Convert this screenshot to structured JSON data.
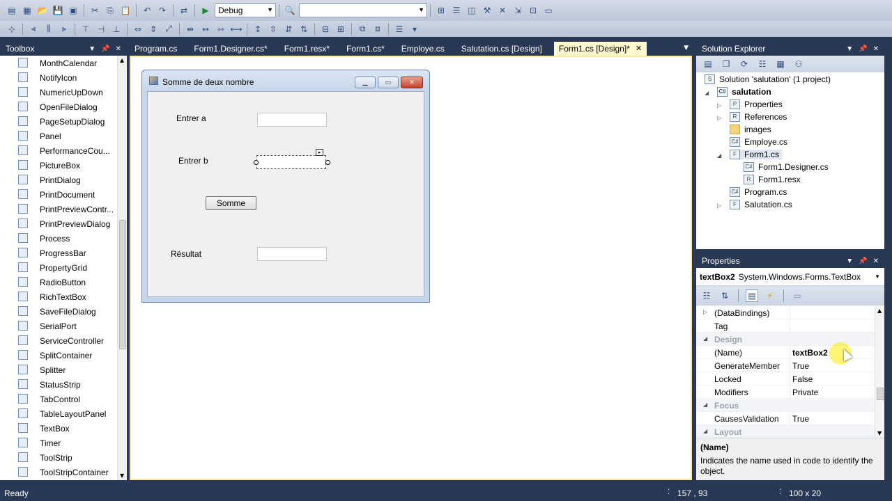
{
  "toolbar": {
    "config": "Debug",
    "platform": ""
  },
  "toolbox": {
    "title": "Toolbox",
    "items": [
      {
        "label": "MonthCalendar",
        "icon": "calendar-icon"
      },
      {
        "label": "NotifyIcon",
        "icon": "notify-icon"
      },
      {
        "label": "NumericUpDown",
        "icon": "numeric-icon"
      },
      {
        "label": "OpenFileDialog",
        "icon": "open-file-icon"
      },
      {
        "label": "PageSetupDialog",
        "icon": "page-setup-icon"
      },
      {
        "label": "Panel",
        "icon": "panel-icon"
      },
      {
        "label": "PerformanceCou...",
        "icon": "perf-icon"
      },
      {
        "label": "PictureBox",
        "icon": "picture-icon"
      },
      {
        "label": "PrintDialog",
        "icon": "print-icon"
      },
      {
        "label": "PrintDocument",
        "icon": "print-doc-icon"
      },
      {
        "label": "PrintPreviewContr...",
        "icon": "print-preview-icon"
      },
      {
        "label": "PrintPreviewDialog",
        "icon": "print-preview-dialog-icon"
      },
      {
        "label": "Process",
        "icon": "process-icon"
      },
      {
        "label": "ProgressBar",
        "icon": "progress-icon"
      },
      {
        "label": "PropertyGrid",
        "icon": "property-grid-icon"
      },
      {
        "label": "RadioButton",
        "icon": "radio-icon"
      },
      {
        "label": "RichTextBox",
        "icon": "rich-text-icon"
      },
      {
        "label": "SaveFileDialog",
        "icon": "save-file-icon"
      },
      {
        "label": "SerialPort",
        "icon": "serial-port-icon"
      },
      {
        "label": "ServiceController",
        "icon": "service-icon"
      },
      {
        "label": "SplitContainer",
        "icon": "split-container-icon"
      },
      {
        "label": "Splitter",
        "icon": "splitter-icon"
      },
      {
        "label": "StatusStrip",
        "icon": "status-strip-icon"
      },
      {
        "label": "TabControl",
        "icon": "tab-control-icon"
      },
      {
        "label": "TableLayoutPanel",
        "icon": "table-layout-icon"
      },
      {
        "label": "TextBox",
        "icon": "textbox-icon"
      },
      {
        "label": "Timer",
        "icon": "timer-icon"
      },
      {
        "label": "ToolStrip",
        "icon": "toolstrip-icon"
      },
      {
        "label": "ToolStripContainer",
        "icon": "toolstrip-container-icon"
      }
    ]
  },
  "tabs": [
    {
      "label": "Program.cs"
    },
    {
      "label": "Form1.Designer.cs*"
    },
    {
      "label": "Form1.resx*"
    },
    {
      "label": "Form1.cs*"
    },
    {
      "label": "Employe.cs"
    },
    {
      "label": "Salutation.cs [Design]"
    },
    {
      "label": "Form1.cs [Design]*"
    }
  ],
  "form": {
    "title": "Somme de deux nombre",
    "label_a": "Entrer a",
    "label_b": "Entrer b",
    "button": "Somme",
    "label_result": "Résultat"
  },
  "solution_explorer": {
    "title": "Solution Explorer",
    "solution": "Solution 'salutation' (1 project)",
    "project": "salutation",
    "nodes": [
      "Properties",
      "References",
      "images",
      "Employe.cs",
      "Form1.cs",
      "Form1.Designer.cs",
      "Form1.resx",
      "Program.cs",
      "Salutation.cs"
    ]
  },
  "properties": {
    "title": "Properties",
    "object_name": "textBox2",
    "object_type": "System.Windows.Forms.TextBox",
    "rows": [
      {
        "name": "(DataBindings)",
        "value": ""
      },
      {
        "name": "Tag",
        "value": ""
      },
      {
        "name": "Design",
        "value": ""
      },
      {
        "name": "(Name)",
        "value": "textBox2"
      },
      {
        "name": "GenerateMember",
        "value": "True"
      },
      {
        "name": "Locked",
        "value": "False"
      },
      {
        "name": "Modifiers",
        "value": "Private"
      },
      {
        "name": "Focus",
        "value": ""
      },
      {
        "name": "CausesValidation",
        "value": "True"
      },
      {
        "name": "Layout",
        "value": ""
      }
    ],
    "desc_title": "(Name)",
    "desc_text": "Indicates the name used in code to identify the object."
  },
  "status": {
    "text": "Ready",
    "position": "157 , 93",
    "size": "100 x 20"
  }
}
